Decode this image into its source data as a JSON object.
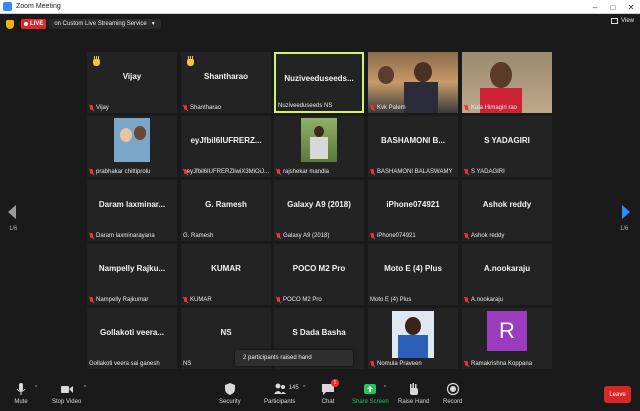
{
  "window": {
    "title": "Zoom Meeting"
  },
  "topbar": {
    "live_label": "LIVE",
    "stream_label": "on Custom Live Streaming Service",
    "view_label": "View"
  },
  "gallery": {
    "page_left": "1/6",
    "page_right": "1/6",
    "tiles": [
      {
        "center": "Vijay",
        "label": "Vijay",
        "hand": true
      },
      {
        "center": "Shantharao",
        "label": "Shantharao",
        "hand": true
      },
      {
        "center": "Nuziveeduseeds...",
        "label": "Nuziveeduseeds NS",
        "active": true,
        "mic": false
      },
      {
        "center": "",
        "label": "Kvk Palem",
        "photo": "men"
      },
      {
        "center": "",
        "label": "Kola Himagiri rao",
        "photo": "man2"
      },
      {
        "center": "",
        "label": "prabhakar chittiprolu",
        "photo": "baby"
      },
      {
        "center": "eyJfbil6IUFRERZ...",
        "label": "eyJfbil6IUFRERZliwiX3MiOiJ..."
      },
      {
        "center": "",
        "label": "rajshekar mandla",
        "photo": "outdoor"
      },
      {
        "center": "BASHAMONI B...",
        "label": "BASHAMONI BALASWAMY"
      },
      {
        "center": "S YADAGIRI",
        "label": "S YADAGIRI"
      },
      {
        "center": "Daram laxminar...",
        "label": "Daram laxminarayana"
      },
      {
        "center": "G. Ramesh",
        "label": "G. Ramesh",
        "mic": false
      },
      {
        "center": "Galaxy A9 (2018)",
        "label": "Galaxy A9 (2018)"
      },
      {
        "center": "iPhone074921",
        "label": "iPhone074921"
      },
      {
        "center": "Ashok reddy",
        "label": "Ashok reddy"
      },
      {
        "center": "Nampelly Rajku...",
        "label": "Nampelly Rajkumar"
      },
      {
        "center": "KUMAR",
        "label": "KUMAR"
      },
      {
        "center": "POCO M2 Pro",
        "label": "POCO M2 Pro"
      },
      {
        "center": "Moto E (4) Plus",
        "label": "Moto E (4) Plus",
        "mic": false
      },
      {
        "center": "A.nookaraju",
        "label": "A.nookaraju"
      },
      {
        "center": "Gollakoti veera...",
        "label": "Gollakoti veera sai ganesh",
        "mic": false
      },
      {
        "center": "NS",
        "label": "NS",
        "mic": false
      },
      {
        "center": "S Dada Basha",
        "label": ""
      },
      {
        "center": "",
        "label": "Nomula Praveen",
        "photo": "portrait"
      },
      {
        "center": "",
        "label": "Ramakrishna Koppana",
        "photo": "R"
      }
    ]
  },
  "tooltip": {
    "text": "2 participants raised hand"
  },
  "toolbar": {
    "mute": "Mute",
    "stop_video": "Stop Video",
    "security": "Security",
    "participants": "Participants",
    "participants_count": "145",
    "chat": "Chat",
    "chat_badge": "1",
    "share_screen": "Share Screen",
    "raise_hand": "Raise Hand",
    "record": "Record",
    "leave": "Leave",
    "avatar_letter": "R"
  },
  "colors": {
    "accent": "#2d8cff",
    "share_green": "#22c55e",
    "leave_red": "#d92626",
    "active_border": "#d4f36b",
    "mic_off": "#e33333"
  }
}
